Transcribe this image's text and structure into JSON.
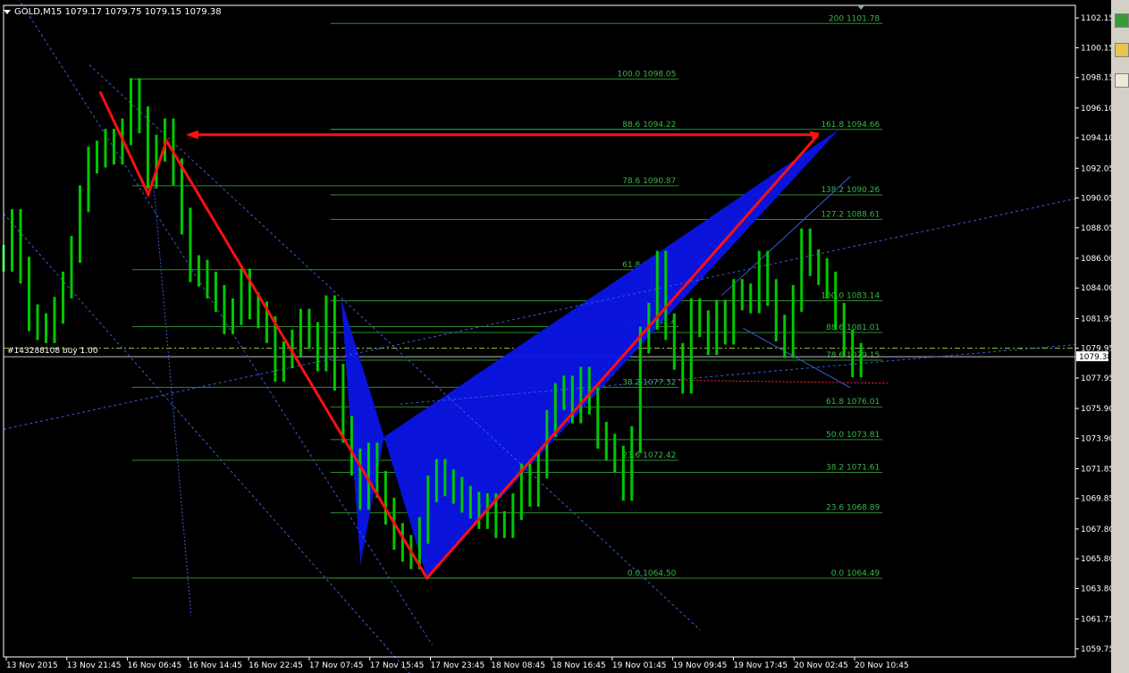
{
  "header": {
    "symbol_timeframe": "GOLD,M15",
    "ohlc": "1079.17 1079.75 1079.15 1079.38"
  },
  "trade_label": "#143288108 buy 1.00",
  "current_price_label": "1079.38",
  "colors": {
    "background": "#000000",
    "frame": "#ffffff",
    "candles": "#00c800",
    "fib_lines": "#2e8b2e",
    "fib_text": "#3cb34a",
    "pattern_fill": "#0a14e6",
    "zigzag": "#ff1010",
    "trend_lines": "#3a5ad8",
    "ask_line": "#9acd32",
    "stop_line": "#ff3030"
  },
  "chart_data": {
    "type": "candlestick",
    "title": "GOLD,M15",
    "ylim": [
      1059.2,
      1103.0
    ],
    "y_ticks": [
      "1102.15",
      "1100.15",
      "1098.15",
      "1096.10",
      "1094.10",
      "1092.05",
      "1090.05",
      "1088.05",
      "1086.00",
      "1084.00",
      "1081.95",
      "1079.95",
      "1077.95",
      "1075.90",
      "1073.90",
      "1071.85",
      "1069.85",
      "1067.80",
      "1065.80",
      "1063.80",
      "1061.75",
      "1059.75"
    ],
    "x_ticks": [
      "13 Nov 2015",
      "13 Nov 21:45",
      "16 Nov 06:45",
      "16 Nov 14:45",
      "16 Nov 22:45",
      "17 Nov 07:45",
      "17 Nov 15:45",
      "17 Nov 23:45",
      "18 Nov 08:45",
      "18 Nov 16:45",
      "19 Nov 01:45",
      "19 Nov 09:45",
      "19 Nov 17:45",
      "20 Nov 02:45",
      "20 Nov 10:45"
    ],
    "fib_levels": [
      {
        "label": "200  1101.78",
        "y": 1101.78,
        "x_start": 0.305,
        "x_end": 0.82
      },
      {
        "label": "100.0  1098.05",
        "y": 1098.05,
        "x_start": 0.12,
        "x_end": 0.63
      },
      {
        "label": "88.6  1094.22",
        "y": 1094.66,
        "x_start": 0.305,
        "x_end": 0.63
      },
      {
        "label": "161.8  1094.66",
        "y": 1094.66,
        "x_start": 0.305,
        "x_end": 0.82
      },
      {
        "label": "78.6  1090.87",
        "y": 1090.87,
        "x_start": 0.12,
        "x_end": 0.63
      },
      {
        "label": "138.2  1090.26",
        "y": 1090.26,
        "x_start": 0.305,
        "x_end": 0.82
      },
      {
        "label": "127.2  1088.61",
        "y": 1088.61,
        "x_start": 0.305,
        "x_end": 0.82
      },
      {
        "label": "61.8  1085.23",
        "y": 1085.23,
        "x_start": 0.12,
        "x_end": 0.63
      },
      {
        "label": "100.0  1083.14",
        "y": 1083.14,
        "x_start": 0.305,
        "x_end": 0.82
      },
      {
        "label": "88.6  1081.01",
        "y": 1081.01,
        "x_start": 0.305,
        "x_end": 0.82
      },
      {
        "label": "50.0  1081.4",
        "y": 1081.4,
        "x_start": 0.12,
        "x_end": 0.63
      },
      {
        "label": "78.6  1079.15",
        "y": 1079.15,
        "x_start": 0.305,
        "x_end": 0.82
      },
      {
        "label": "38.2  1077.32",
        "y": 1077.32,
        "x_start": 0.12,
        "x_end": 0.63
      },
      {
        "label": "61.8  1076.01",
        "y": 1076.01,
        "x_start": 0.305,
        "x_end": 0.82
      },
      {
        "label": "50.0  1073.81",
        "y": 1073.81,
        "x_start": 0.305,
        "x_end": 0.82
      },
      {
        "label": "23.6  1072.42",
        "y": 1072.42,
        "x_start": 0.12,
        "x_end": 0.63
      },
      {
        "label": "38.2  1071.61",
        "y": 1071.61,
        "x_start": 0.305,
        "x_end": 0.82
      },
      {
        "label": "23.6  1068.89",
        "y": 1068.89,
        "x_start": 0.305,
        "x_end": 0.82
      },
      {
        "label": "0.0  1064.50",
        "y": 1064.5,
        "x_start": 0.12,
        "x_end": 0.63
      },
      {
        "label": "0.0  1064.49",
        "y": 1064.49,
        "x_start": 0.305,
        "x_end": 0.82
      }
    ],
    "current_price": 1079.38,
    "ask_price": 1079.95,
    "zigzag": [
      [
        0.09,
        1097.2
      ],
      [
        0.135,
        1090.3
      ],
      [
        0.152,
        1093.9
      ],
      [
        0.395,
        1064.5
      ],
      [
        0.76,
        1094.3
      ]
    ],
    "zigzag_arrow": [
      [
        0.76,
        1094.3
      ],
      [
        0.175,
        1094.3
      ]
    ],
    "pattern": {
      "leg1": [
        [
          0.315,
          1083.3
        ],
        [
          0.333,
          1065.4
        ],
        [
          0.355,
          1074.0
        ]
      ],
      "leg2": [
        [
          0.355,
          1074.0
        ],
        [
          0.395,
          1064.5
        ],
        [
          0.78,
          1094.7
        ],
        [
          0.64,
          1087.8
        ]
      ]
    },
    "candles_close": [
      1086,
      1088.4,
      1085.2,
      1082,
      1081.4,
      1081.2,
      1082.5,
      1084.2,
      1086.6,
      1090,
      1092.6,
      1093,
      1093.8,
      1093.2,
      1094.5,
      1097.2,
      1095.3,
      1091.6,
      1093.4,
      1094.5,
      1091.8,
      1088.5,
      1085.3,
      1085,
      1084.2,
      1083.3,
      1081.8,
      1082.4,
      1084.4,
      1082.8,
      1082.2,
      1081.2,
      1078.6,
      1079.5,
      1080.3,
      1081.7,
      1080.8,
      1079.3,
      1082.6,
      1078,
      1074.5,
      1072.3,
      1070,
      1072.7,
      1070.8,
      1069,
      1067.3,
      1066.5,
      1066,
      1067.7,
      1070.5,
      1071.6,
      1070.9,
      1070.4,
      1069.8,
      1069.4,
      1068.7,
      1069.3,
      1068.1,
      1068.1,
      1069.3,
      1071.3,
      1070.2,
      1072.1,
      1074.9,
      1076.7,
      1077.2,
      1075.8,
      1077.8,
      1076.4,
      1074.1,
      1073.3,
      1072.5,
      1070.6,
      1073.8,
      1080.5,
      1082.1,
      1085.6,
      1081.4,
      1079.4,
      1077.8,
      1082.4,
      1081.6,
      1080.4,
      1082.3,
      1081.1,
      1083.7,
      1083.4,
      1083.2,
      1085.6,
      1083.7,
      1081.3,
      1080.2,
      1083.3,
      1087.1,
      1085.7,
      1085.1,
      1084.2,
      1082.1,
      1080.3,
      1078.9,
      1079.4
    ]
  }
}
